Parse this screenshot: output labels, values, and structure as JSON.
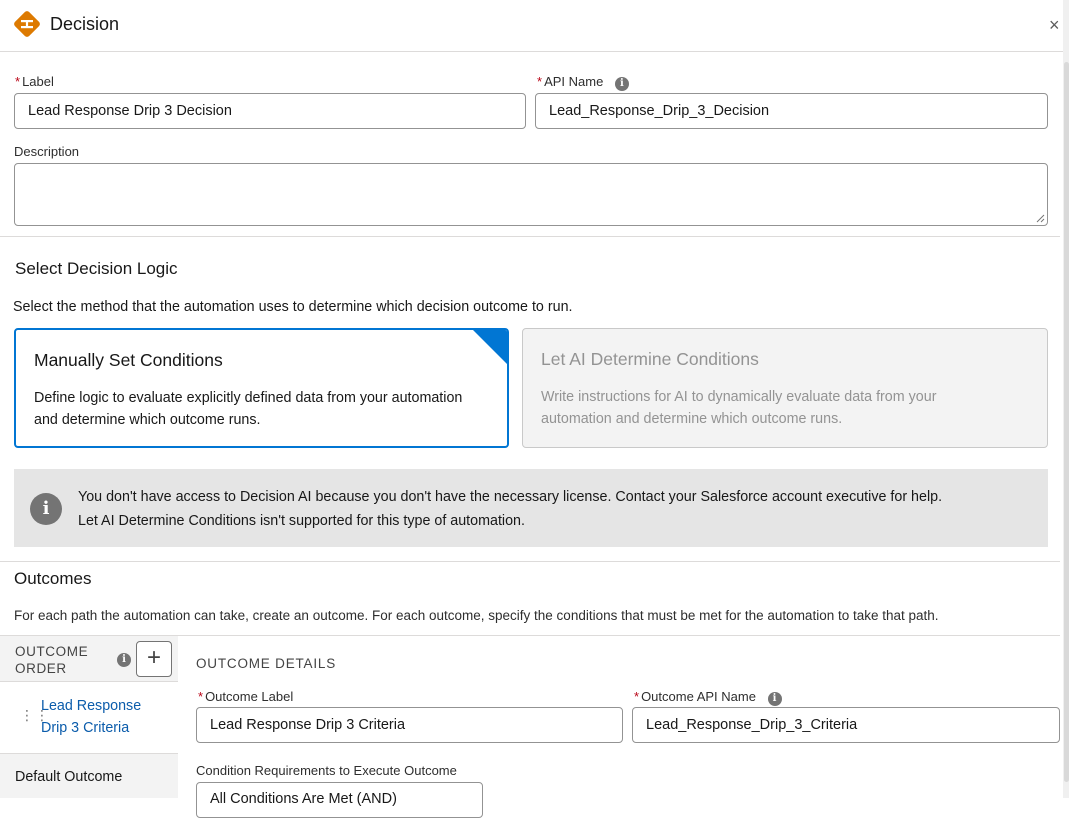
{
  "header": {
    "title": "Decision",
    "close_label": "×",
    "icon": "decision-diamond-icon",
    "icon_color": "#dd7a01"
  },
  "fields": {
    "label": {
      "label": "Label",
      "required_mark": "*",
      "value": "Lead Response Drip 3 Decision"
    },
    "api_name": {
      "label": "API Name",
      "required_mark": "*",
      "value": "Lead_Response_Drip_3_Decision"
    },
    "description": {
      "label": "Description",
      "value": ""
    }
  },
  "decision_logic": {
    "title": "Select Decision Logic",
    "description": "Select the method that the automation uses to determine which decision outcome to run.",
    "options": [
      {
        "title": "Manually Set Conditions",
        "description_line1": "Define logic to evaluate explicitly defined data from your automation",
        "description_line2": "and determine which outcome runs.",
        "selected": true,
        "disabled": false
      },
      {
        "title": "Let AI Determine Conditions",
        "description_line1": "Write instructions for AI to dynamically evaluate data from your",
        "description_line2": "automation and determine which outcome runs.",
        "selected": false,
        "disabled": true
      }
    ],
    "notice": {
      "line1": "You don't have access to Decision AI because you don't have the necessary license. Contact your Salesforce account executive for help.",
      "line2": "Let AI Determine Conditions isn't supported for this type of automation."
    }
  },
  "outcomes": {
    "title": "Outcomes",
    "description": "For each path the automation can take, create an outcome. For each outcome, specify the conditions that must be met for the automation to take that path.",
    "order": {
      "header_line1": "OUTCOME",
      "header_line2": "ORDER",
      "add_label": "+",
      "items": [
        {
          "line1": "Lead Response",
          "line2": "Drip 3 Criteria"
        }
      ],
      "default_label": "Default Outcome"
    },
    "details": {
      "header": "OUTCOME DETAILS",
      "outcome_label": {
        "label": "Outcome Label",
        "required_mark": "*",
        "value": "Lead Response Drip 3 Criteria"
      },
      "outcome_api_name": {
        "label": "Outcome API Name",
        "required_mark": "*",
        "value": "Lead_Response_Drip_3_Criteria"
      },
      "condition_requirements": {
        "label": "Condition Requirements to Execute Outcome",
        "value": "All Conditions Are Met (AND)"
      }
    }
  },
  "colors": {
    "accent": "#0176d3",
    "link": "#0b5cab",
    "required": "#ba0517"
  }
}
